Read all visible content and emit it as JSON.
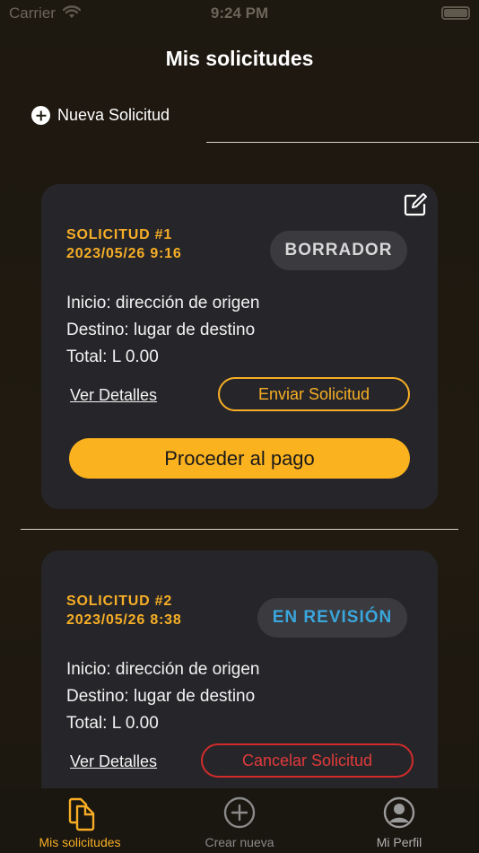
{
  "status_bar": {
    "carrier": "Carrier",
    "time": "9:24 PM"
  },
  "page": {
    "title": "Mis solicitudes"
  },
  "new_request": {
    "label": "Nueva Solicitud",
    "icon": "plus-circle-icon"
  },
  "colors": {
    "accent": "#f7ae26",
    "pay_button": "#fbb21f",
    "review": "#3aa6dc",
    "cancel": "#d22b2b",
    "card": "#26262a",
    "background": "#1f1a12"
  },
  "requests": [
    {
      "title": "SOLICITUD #1",
      "date": "2023/05/26 9:16",
      "status": "BORRADOR",
      "origin": "Inicio: dirección de origen",
      "destination": "Destino: lugar de destino",
      "total": "Total: L 0.00",
      "details_label": "Ver Detalles",
      "action_label": "Enviar Solicitud",
      "pay_label": "Proceder al pago",
      "edit_icon": "edit-icon"
    },
    {
      "title": "SOLICITUD #2",
      "date": "2023/05/26 8:38",
      "status": "EN REVISIÓN",
      "origin": "Inicio: dirección de origen",
      "destination": "Destino: lugar de destino",
      "total": "Total: L 0.00",
      "details_label": "Ver Detalles",
      "action_label": "Cancelar Solicitud"
    }
  ],
  "tab_bar": {
    "tabs": [
      {
        "label": "Mis solicitudes",
        "icon": "documents-icon",
        "active": true,
        "color": "#f7ae26"
      },
      {
        "label": "Crear nueva",
        "icon": "plus-circle-icon",
        "active": false,
        "color": "#8a8a8a"
      },
      {
        "label": "Mi Perfil",
        "icon": "profile-icon",
        "active": false,
        "color": "#8a8a8a"
      }
    ]
  }
}
